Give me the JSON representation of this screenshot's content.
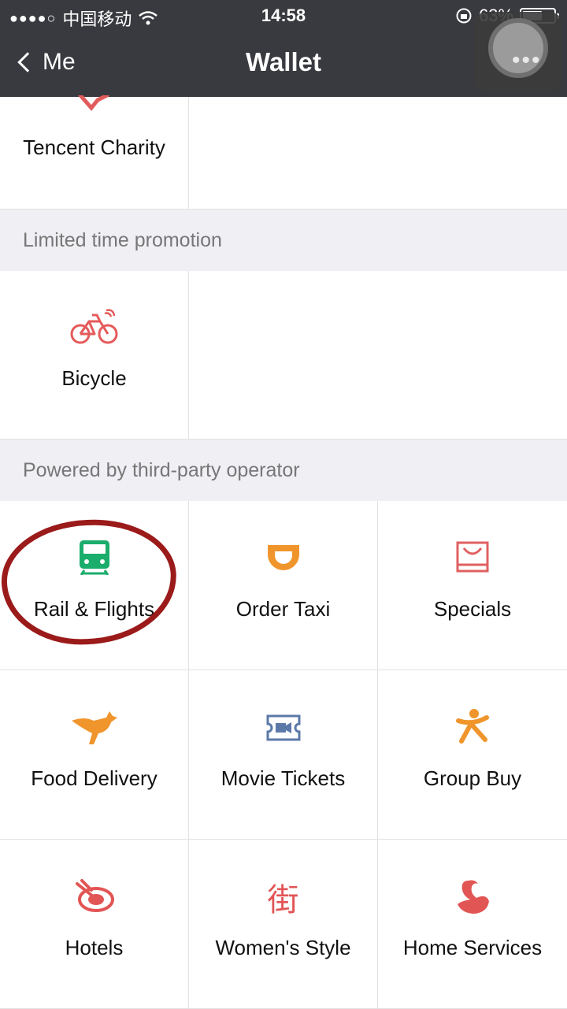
{
  "status": {
    "signal": "●●●●○",
    "carrier": "中国移动",
    "time": "14:58",
    "battery": "63%",
    "battery_level": 0.63
  },
  "nav": {
    "back_label": "Me",
    "title": "Wallet"
  },
  "top_grid": {
    "items": [
      {
        "label": "Tencent Charity",
        "icon": "charity-icon"
      }
    ]
  },
  "promo": {
    "header": "Limited time promotion",
    "items": [
      {
        "label": "Bicycle",
        "icon": "bicycle-icon"
      }
    ]
  },
  "third_party": {
    "header": "Powered by third-party operator",
    "items": [
      {
        "label": "Rail & Flights",
        "icon": "train-icon"
      },
      {
        "label": "Order Taxi",
        "icon": "taxi-icon"
      },
      {
        "label": "Specials",
        "icon": "shopping-bag-icon"
      },
      {
        "label": "Food Delivery",
        "icon": "kangaroo-icon"
      },
      {
        "label": "Movie Tickets",
        "icon": "ticket-icon"
      },
      {
        "label": "Group Buy",
        "icon": "group-buy-icon"
      },
      {
        "label": "Hotels",
        "icon": "hotel-icon"
      },
      {
        "label": "Women's Style",
        "icon": "street-icon"
      },
      {
        "label": "Home Services",
        "icon": "swan-icon"
      }
    ]
  },
  "icon_glyphs": {
    "street": "街"
  },
  "colors": {
    "nav_bg": "#393a3f",
    "charity": "#e25b5b",
    "bicycle": "#e55a5a",
    "train": "#1aad6c",
    "taxi": "#f0952c",
    "specials": "#e06060",
    "food": "#f0952c",
    "movie": "#5c79a8",
    "group": "#f0952c",
    "hotel": "#e25555",
    "women": "#e25555",
    "home": "#e25555",
    "annotation": "#9b1a1a"
  }
}
